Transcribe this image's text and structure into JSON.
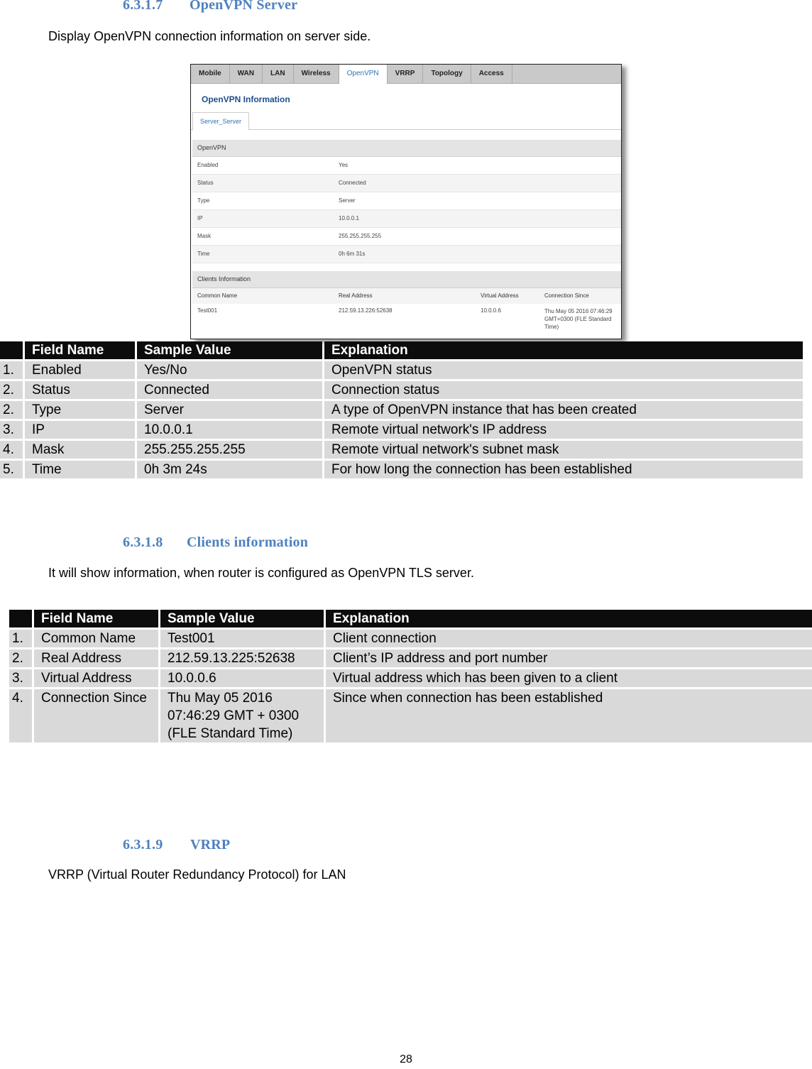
{
  "sections": [
    {
      "number": "6.3.1.7",
      "title": "OpenVPN Server",
      "description": "Display OpenVPN connection information on server side."
    },
    {
      "number": "6.3.1.8",
      "title": "Clients information",
      "description": "It will show information, when router is configured as OpenVPN TLS server."
    },
    {
      "number": "6.3.1.9",
      "title": "VRRP",
      "description": "VRRP (Virtual Router Redundancy Protocol) for LAN"
    }
  ],
  "screenshot": {
    "tabs": [
      "Mobile",
      "WAN",
      "LAN",
      "Wireless",
      "OpenVPN",
      "VRRP",
      "Topology",
      "Access"
    ],
    "active_tab": "OpenVPN",
    "title": "OpenVPN Information",
    "subtab": "Server_Server",
    "openvpn_section": {
      "heading": "OpenVPN",
      "rows": [
        {
          "key": "Enabled",
          "value": "Yes"
        },
        {
          "key": "Status",
          "value": "Connected"
        },
        {
          "key": "Type",
          "value": "Server"
        },
        {
          "key": "IP",
          "value": "10.0.0.1"
        },
        {
          "key": "Mask",
          "value": "255.255.255.255"
        },
        {
          "key": "Time",
          "value": "0h 6m 31s"
        }
      ]
    },
    "clients_section": {
      "heading": "Clients Information",
      "columns": [
        "Common Name",
        "Real Address",
        "Virtual Address",
        "Connection Since"
      ],
      "rows": [
        [
          "Test001",
          "212.59.13.226:52638",
          "10.0.0.6",
          "Thu May 05 2016 07:46:29 GMT+0300 (FLE Standard Time)"
        ]
      ]
    }
  },
  "table1": {
    "headers": [
      "",
      "Field Name",
      "Sample Value",
      "Explanation"
    ],
    "rows": [
      [
        "1.",
        "Enabled",
        "Yes/No",
        "OpenVPN status"
      ],
      [
        "2.",
        "Status",
        "Connected",
        "Connection status"
      ],
      [
        "2.",
        "Type",
        "Server",
        "A type of OpenVPN instance that has been created"
      ],
      [
        "3.",
        "IP",
        "10.0.0.1",
        "Remote virtual network's IP address"
      ],
      [
        "4.",
        "Mask",
        "255.255.255.255",
        "Remote virtual network's subnet mask"
      ],
      [
        "5.",
        "Time",
        "0h 3m 24s",
        "For how long the connection has been established"
      ]
    ]
  },
  "table2": {
    "headers": [
      "",
      "Field Name",
      "Sample Value",
      "Explanation"
    ],
    "rows": [
      [
        "1.",
        "Common Name",
        "Test001",
        "Client connection"
      ],
      [
        "2.",
        "Real Address",
        "212.59.13.225:52638",
        "Client’s IP address and port number"
      ],
      [
        "3.",
        "Virtual Address",
        "10.0.0.6",
        "Virtual address which has been given to a client"
      ],
      [
        "4.",
        "Connection Since",
        "Thu May 05 2016\n07:46:29 GMT + 0300\n(FLE Standard Time)",
        "Since when connection has been established"
      ]
    ]
  },
  "page_number": "28"
}
